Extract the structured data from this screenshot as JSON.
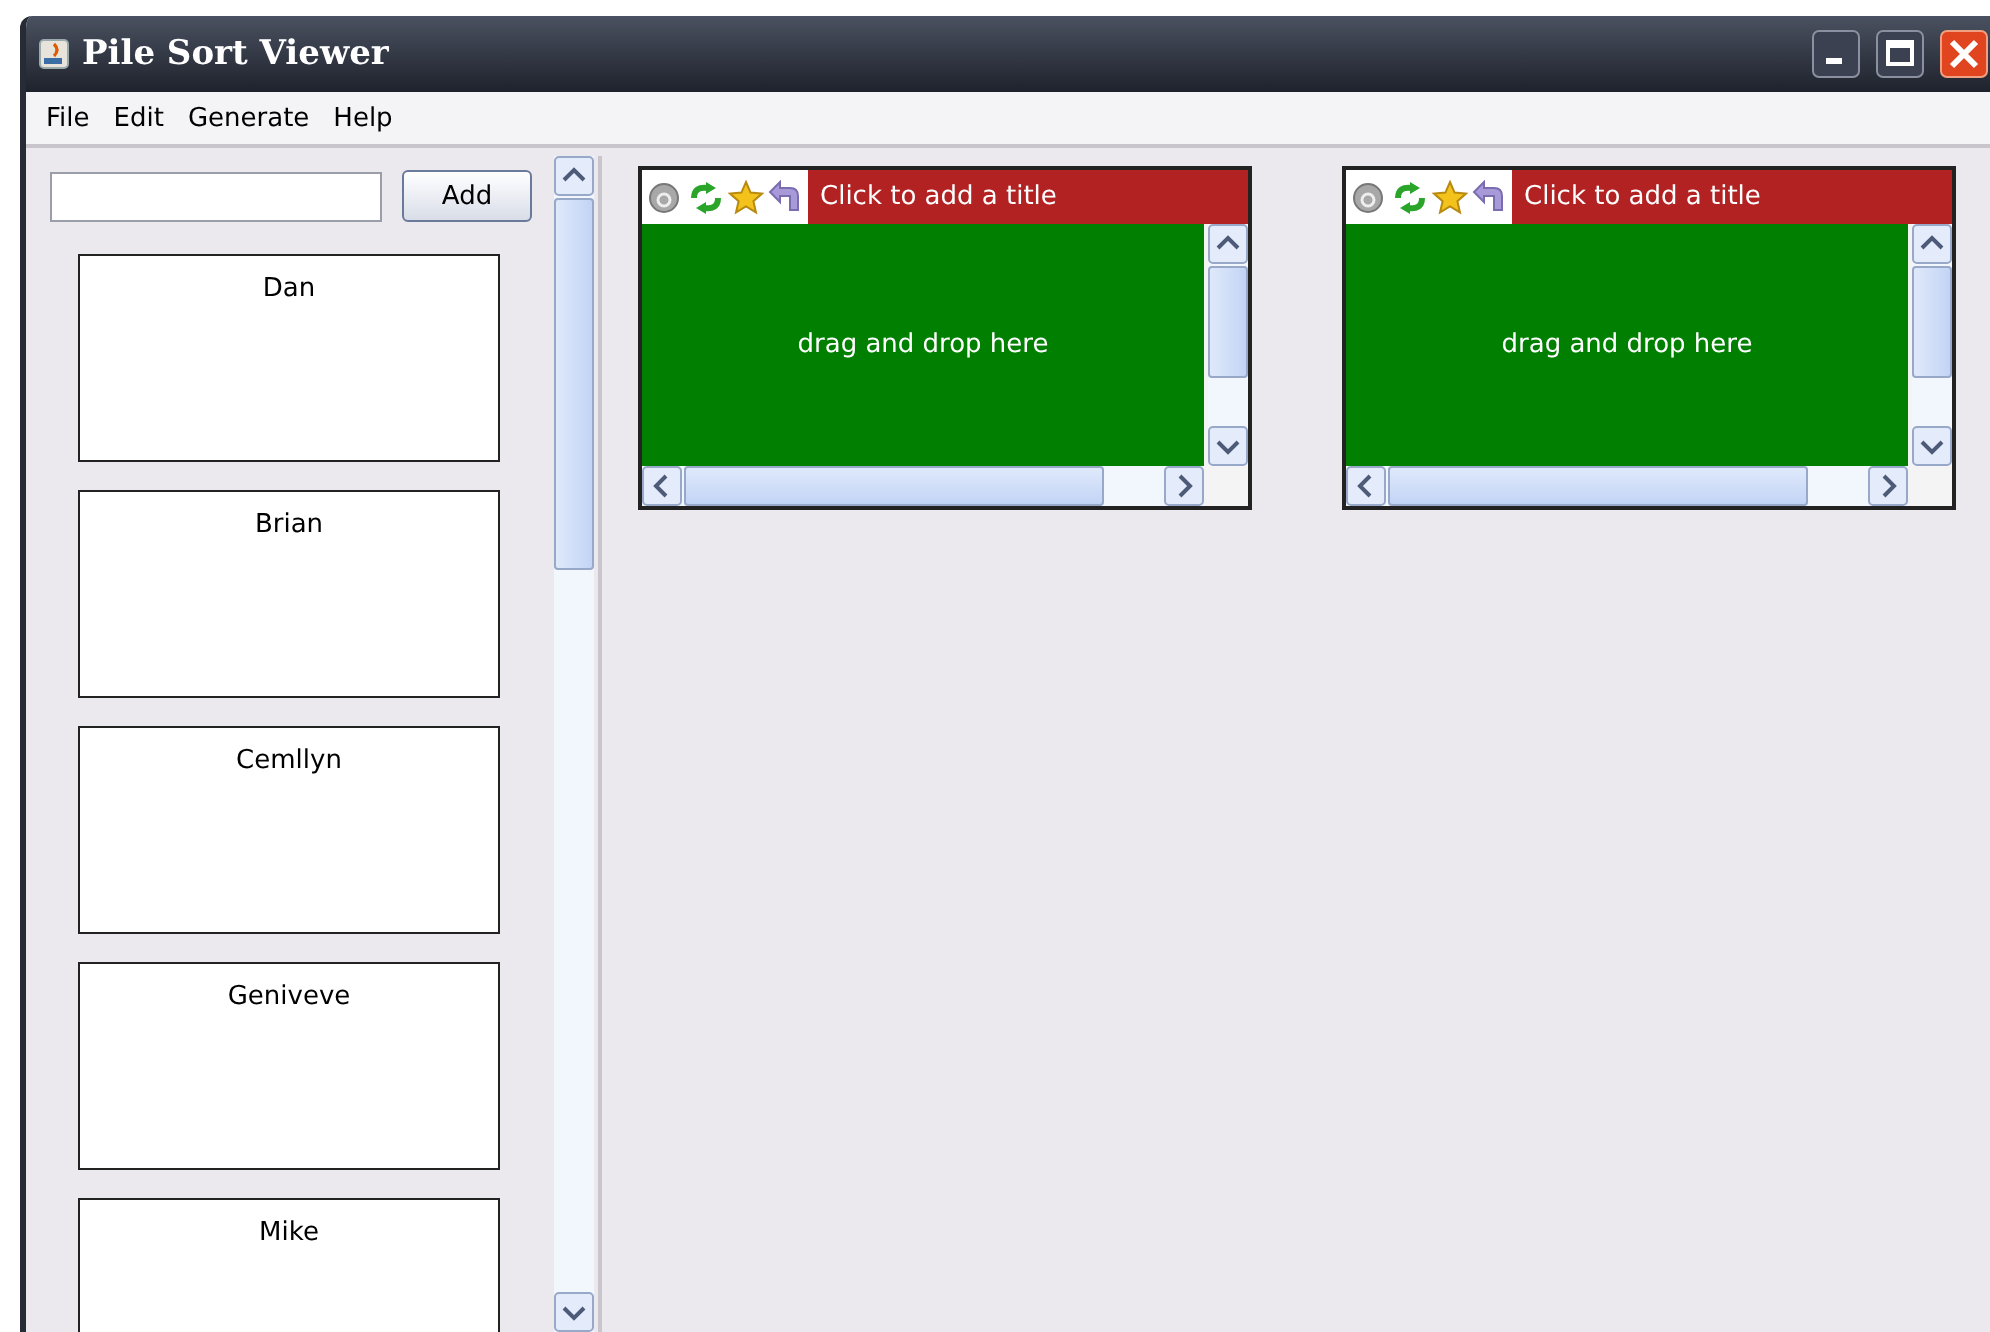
{
  "window": {
    "title": "Pile Sort Viewer"
  },
  "menu": [
    {
      "label": "File"
    },
    {
      "label": "Edit"
    },
    {
      "label": "Generate"
    },
    {
      "label": "Help"
    }
  ],
  "add_button": {
    "label": "Add"
  },
  "cards": [
    {
      "name": "Dan"
    },
    {
      "name": "Brian"
    },
    {
      "name": "Cemllyn"
    },
    {
      "name": "Geniveve"
    },
    {
      "name": "Mike"
    }
  ],
  "piles": [
    {
      "title": "Click to add a title",
      "body": "drag and drop here"
    },
    {
      "title": "Click to add a title",
      "body": "drag and drop here"
    }
  ]
}
